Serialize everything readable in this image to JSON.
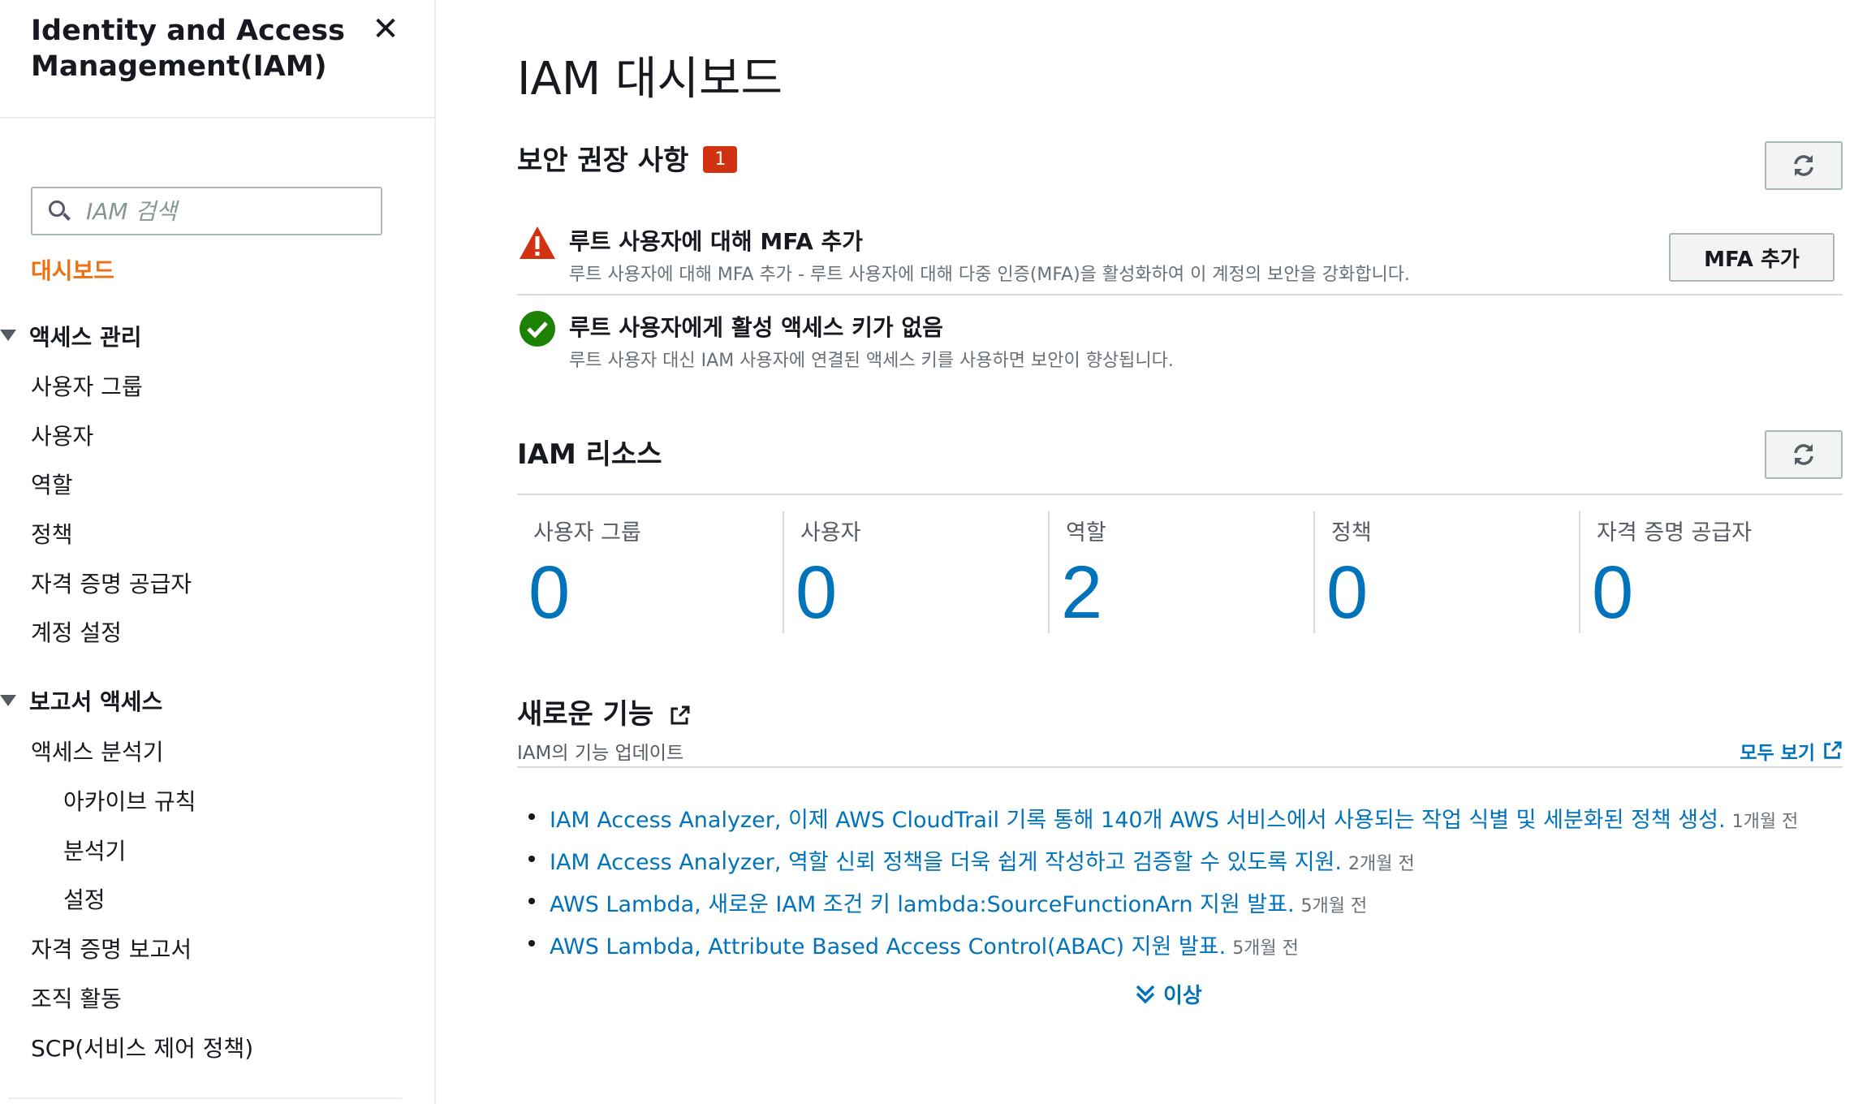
{
  "sidebar": {
    "title_line1": "Identity and Access",
    "title_line2": "Management(IAM)",
    "close_icon": "close-icon",
    "search_placeholder": "IAM 검색",
    "dashboard": "대시보드",
    "access_management": {
      "label": "액세스 관리",
      "items": [
        "사용자 그룹",
        "사용자",
        "역할",
        "정책",
        "자격 증명 공급자",
        "계정 설정"
      ]
    },
    "access_reports": {
      "label": "보고서 액세스",
      "analyzer": "액세스 분석기",
      "analyzer_items": [
        "아카이브 규칙",
        "분석기",
        "설정"
      ],
      "items": [
        "자격 증명 보고서",
        "조직 활동",
        "SCP(서비스 제어 정책)"
      ]
    }
  },
  "main": {
    "title": "IAM 대시보드",
    "security": {
      "title": "보안 권장 사항",
      "badge": "1",
      "recommendations": [
        {
          "status": "warning",
          "icon": "warning-icon",
          "title": "루트 사용자에 대해 MFA 추가",
          "description": "루트 사용자에 대해 MFA 추가 - 루트 사용자에 대해 다중 인증(MFA)을 활성화하여 이 계정의 보안을 강화합니다.",
          "button": "MFA 추가"
        },
        {
          "status": "success",
          "icon": "check-circle-icon",
          "title": "루트 사용자에게 활성 액세스 키가 없음",
          "description": "루트 사용자 대신 IAM 사용자에 연결된 액세스 키를 사용하면 보안이 향상됩니다."
        }
      ]
    },
    "resources": {
      "title": "IAM 리소스",
      "items": [
        {
          "label": "사용자 그룹",
          "value": "0"
        },
        {
          "label": "사용자",
          "value": "0"
        },
        {
          "label": "역할",
          "value": "2"
        },
        {
          "label": "정책",
          "value": "0"
        },
        {
          "label": "자격 증명 공급자",
          "value": "0"
        }
      ]
    },
    "features": {
      "title": "새로운 기능",
      "subtitle": "IAM의 기능 업데이트",
      "see_all": "모두 보기",
      "items": [
        {
          "text": "IAM Access Analyzer, 이제 AWS CloudTrail 기록 통해 140개 AWS 서비스에서 사용되는 작업 식별 및 세분화된 정책 생성.",
          "time": "1개월 전"
        },
        {
          "text": "IAM Access Analyzer, 역할 신뢰 정책을 더욱 쉽게 작성하고 검증할 수 있도록 지원.",
          "time": "2개월 전"
        },
        {
          "text": "AWS Lambda, 새로운 IAM 조건 키 lambda:SourceFunctionArn 지원 발표.",
          "time": "5개월 전"
        },
        {
          "text": "AWS Lambda, Attribute Based Access Control(ABAC) 지원 발표.",
          "time": "5개월 전"
        }
      ],
      "more": "이상"
    }
  },
  "colors": {
    "accent_orange": "#ec7211",
    "link_blue": "#0073bb",
    "warning_red": "#d13212",
    "success_green": "#1d8102"
  }
}
